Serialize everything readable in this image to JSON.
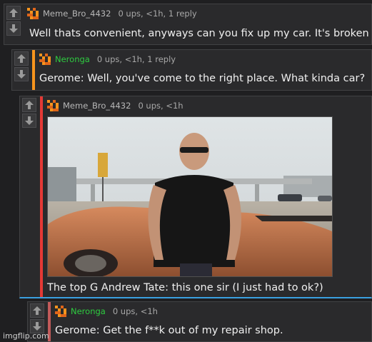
{
  "comments": [
    {
      "username": "Meme_Bro_4432",
      "meta": "0 ups, <1h, 1 reply",
      "text": "Well thats convenient, anyways can you fix up my car. It's broken"
    },
    {
      "username": "Neronga",
      "meta": "0 ups, <1h, 1 reply",
      "text": "Gerome: Well, you've come to the right place. What kinda car?"
    },
    {
      "username": "Meme_Bro_4432",
      "meta": "0 ups, <1h",
      "text": "The top G Andrew Tate: this one sir (I just had to ok?)"
    },
    {
      "username": "Neronga",
      "meta": "0 ups, <1h",
      "text": "Gerome: Get the f**k out of my repair shop."
    }
  ],
  "watermark": "imgflip.com",
  "colors": {
    "bar_orange": "#f7941d",
    "bar_red": "#e53935",
    "bar_rose": "#c15a5a",
    "username_neronga": "#2ecc40",
    "username_default": "#b7b7b7",
    "link_blue": "#3aa0e0"
  },
  "icons": [
    "upvote-arrow-icon",
    "downvote-arrow-icon",
    "pixel-avatar-icon"
  ]
}
